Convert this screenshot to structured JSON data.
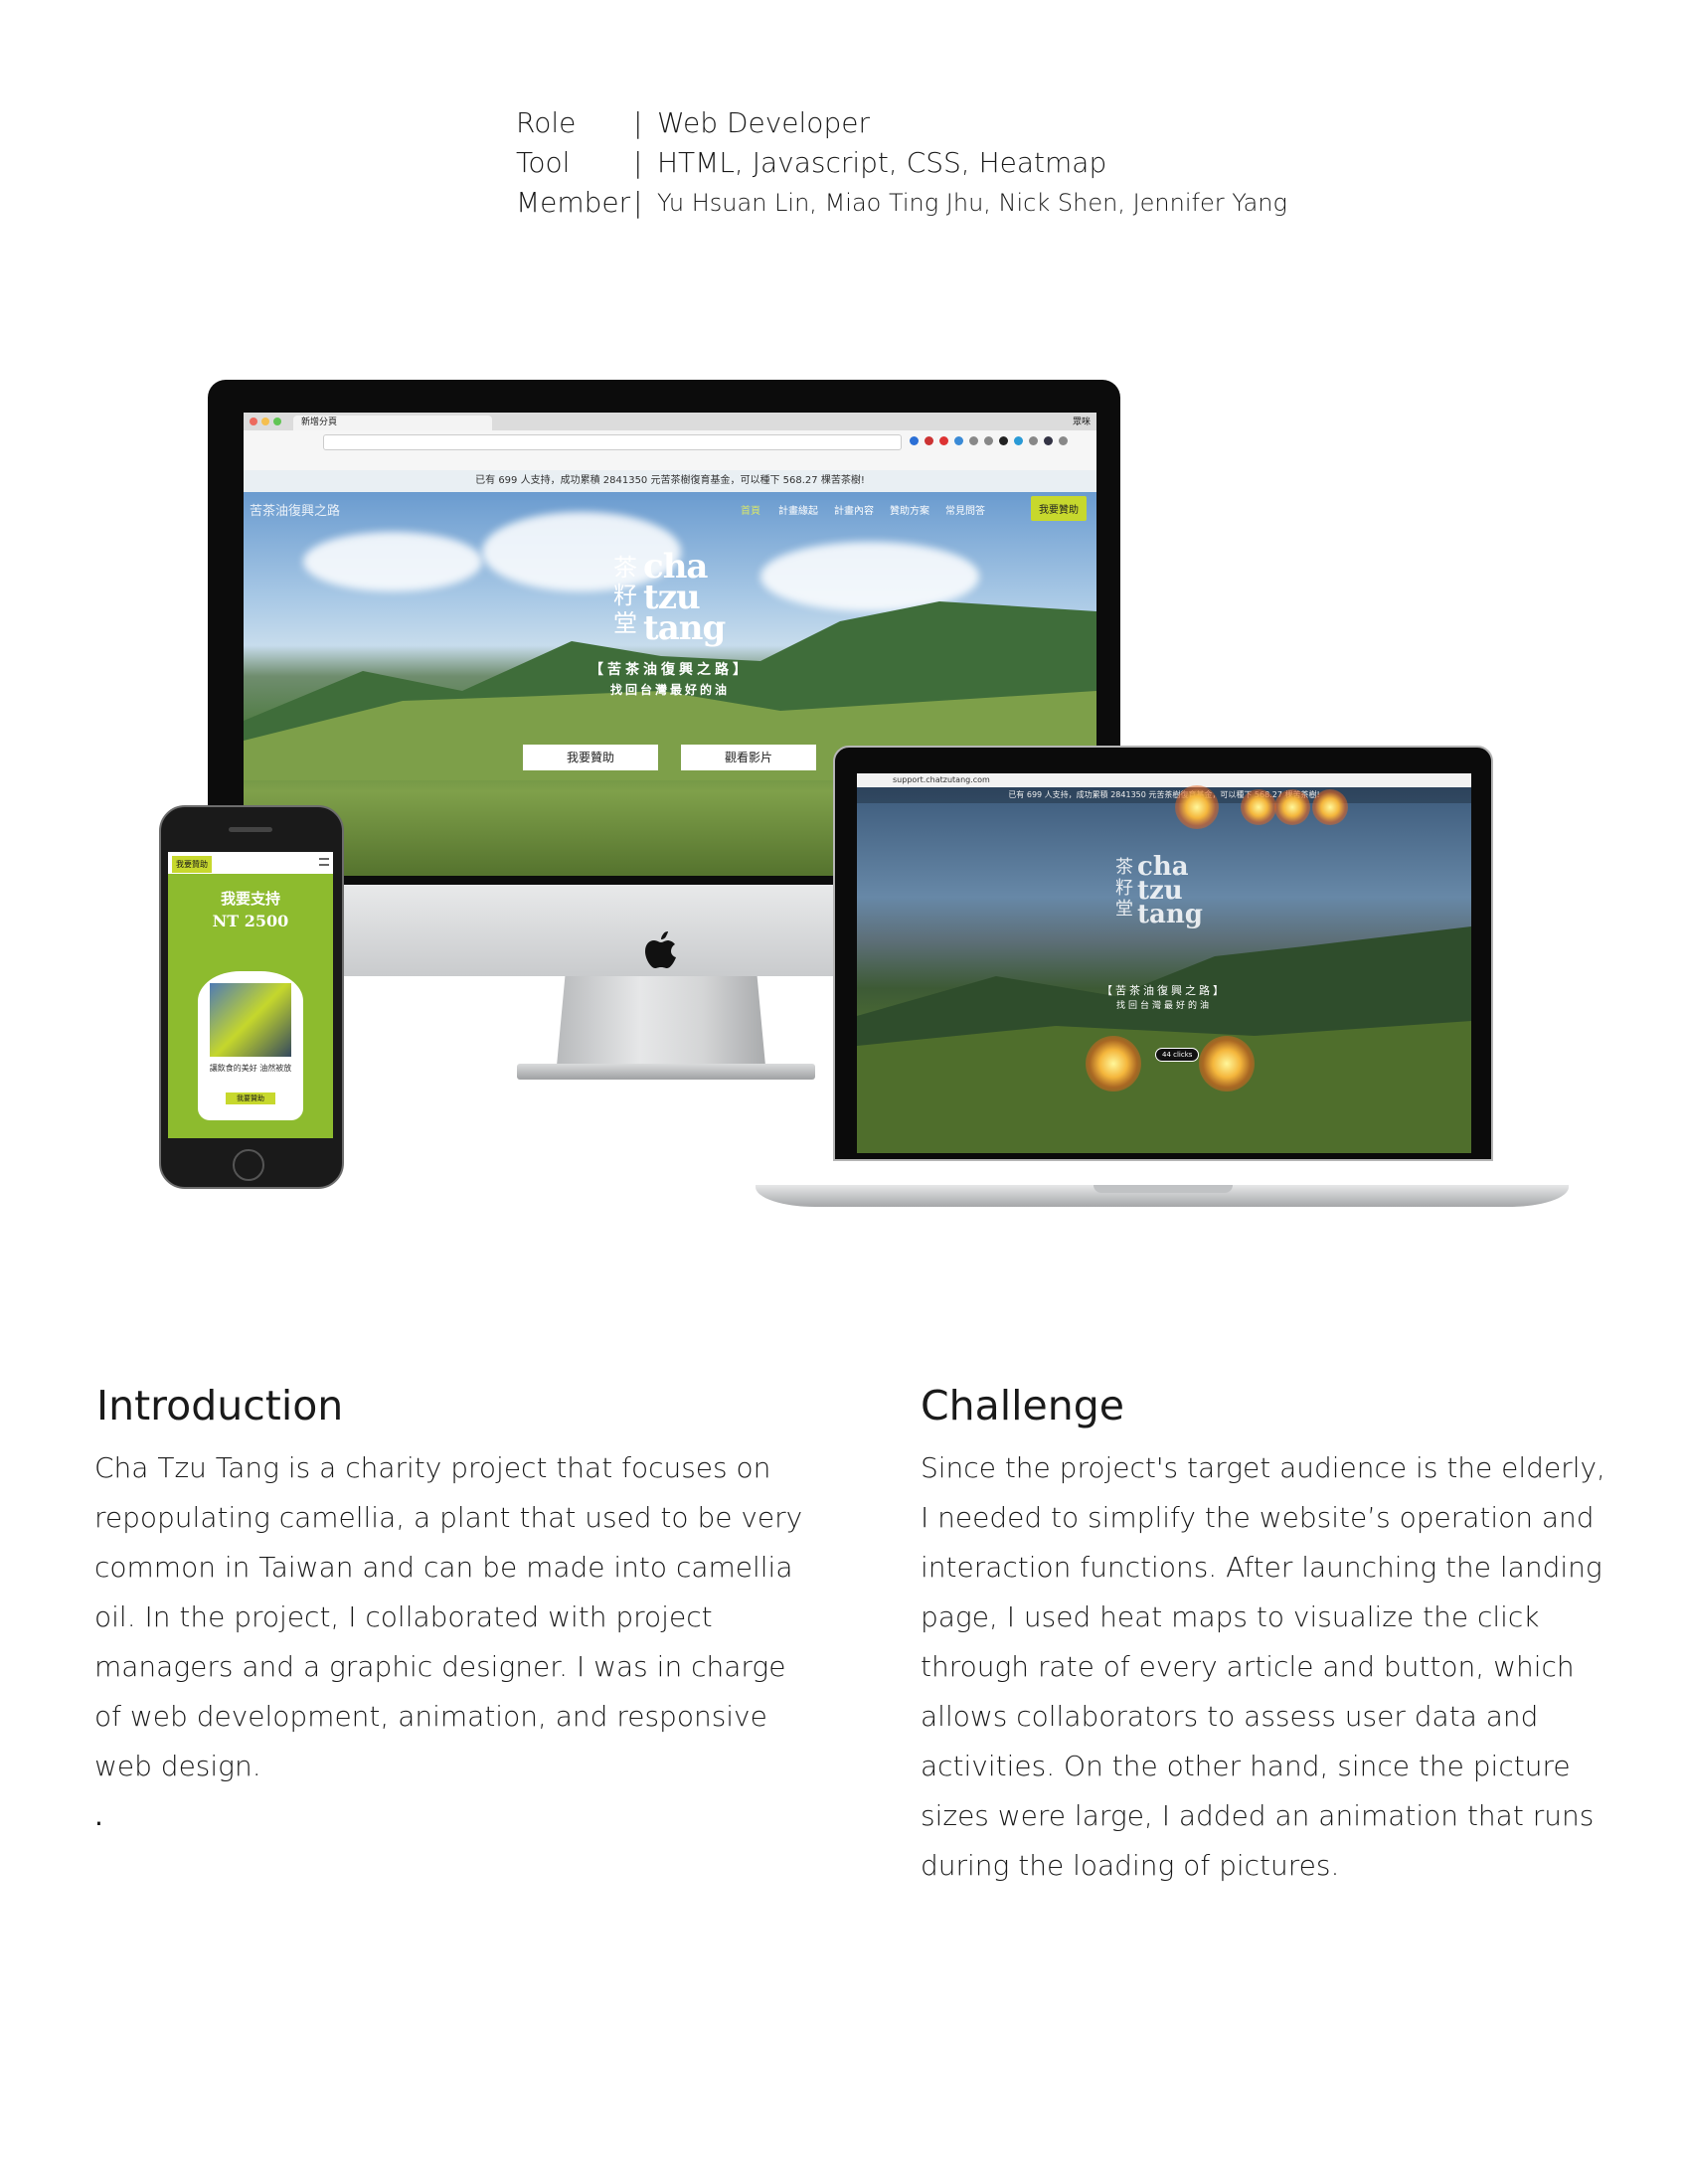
{
  "meta": {
    "rows": [
      {
        "key": "Role",
        "sep": "|",
        "value": "Web Developer"
      },
      {
        "key": "Tool",
        "sep": "|",
        "value": "HTML, Javascript, CSS, Heatmap"
      },
      {
        "key": "Member",
        "sep": "|",
        "value": "Yu Hsuan Lin, Miao Ting Jhu, Nick Shen, Jennifer Yang"
      }
    ]
  },
  "imac_site": {
    "tab_title": "新增分頁",
    "browser_corner": "眾咪",
    "banner": "已有 699 人支持，成功累積 2841350 元苦茶樹復育基金，可以種下 568.27 棵苦茶樹!",
    "logo_text": "苦茶油復興之路",
    "nav": [
      "首頁",
      "計畫緣起",
      "計畫內容",
      "贊助方案",
      "常見問答"
    ],
    "nav_cta": "我要贊助",
    "logo_cn": "茶籽堂",
    "logo_en": "cha tzu tang",
    "subtitle": "【苦茶油復興之路】",
    "tagline": "找回台灣最好的油",
    "btn_primary": "我要贊助",
    "btn_secondary": "觀看影片"
  },
  "macbook_site": {
    "url": "support.chatzutang.com",
    "banner": "已有 699 人支持，成功累積 2841350 元苦茶樹復育基金，可以種下 568.27 棵苦茶樹!",
    "logo_cn": "茶籽堂",
    "logo_en": "cha tzu tang",
    "subtitle": "【苦茶油復興之路】",
    "tagline": "找回台灣最好的油",
    "clicks": "44 clicks"
  },
  "phone_site": {
    "cta": "我要贊助",
    "heading": "我要支持",
    "price": "NT 2500",
    "card_text": "讓飲食的美好 油然被放",
    "card_btn": "我要贊助"
  },
  "introduction": {
    "title": "Introduction",
    "body": "Cha Tzu Tang is a charity project that focuses on repopulating camellia, a plant that used to be very common in Taiwan and can be made into camellia oil. In the project, I collaborated with project managers and a graphic designer. I was in charge of web development, animation, and responsive web design.",
    "trailing": "."
  },
  "challenge": {
    "title": "Challenge",
    "body": "Since the project's target audience is the elderly, I needed to simplify the website’s operation and interaction functions. After launching the landing page, I used heat maps to visualize the click through rate of every article and button, which allows collaborators to assess user data and activities. On the other hand, since the picture sizes were large, I added an animation that runs during the loading of pictures."
  },
  "colors": {
    "accent_green": "#c7d82d",
    "text": "#1a1a1a"
  }
}
